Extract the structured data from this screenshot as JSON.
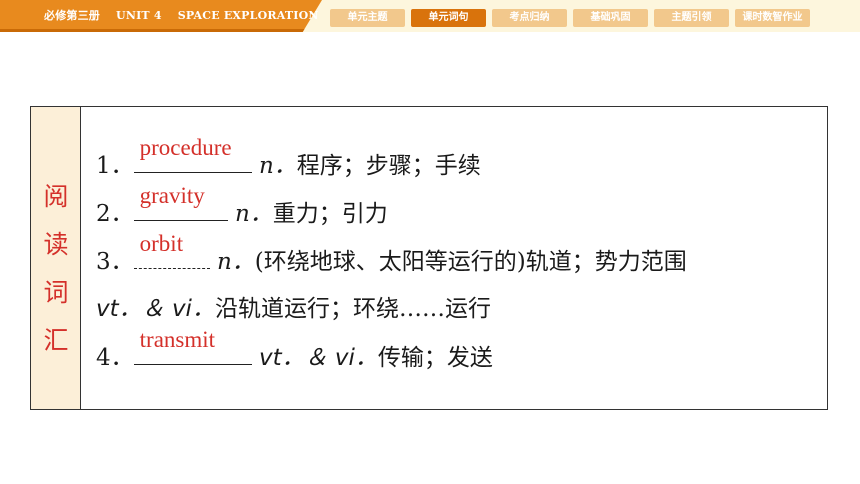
{
  "header": {
    "book": "必修第三册",
    "unit": "UNIT 4",
    "topic": "SPACE EXPLORATION"
  },
  "nav": {
    "tabs": [
      "单元主题",
      "单元词句",
      "考点归纳",
      "基础巩固",
      "主题引领",
      "课时数智作业"
    ],
    "active_index": 1
  },
  "section": {
    "label_chars": [
      "阅",
      "读",
      "词",
      "汇"
    ]
  },
  "vocab": [
    {
      "num": "1．",
      "answer": "procedure",
      "pos": "n．",
      "meaning": "程序；步骤；手续"
    },
    {
      "num": "2．",
      "answer": "gravity",
      "pos": "n．",
      "meaning": "重力；引力"
    },
    {
      "num": "3．",
      "answer": "orbit",
      "pos": "n．",
      "meaning": "(环绕地球、太阳等运行的)轨道；势力范围",
      "line2_pos": "vt．＆ vi．",
      "line2_meaning": "沿轨道运行；环绕……运行"
    },
    {
      "num": "4．",
      "answer": "transmit",
      "pos": "vt．＆ vi．",
      "meaning": "传输；发送"
    }
  ],
  "colors": {
    "header_orange": "#e88a1e",
    "tab_active": "#d9730c",
    "tab_inactive": "#f2c88c",
    "answer_red": "#d4302a",
    "side_bg": "#fcefd8"
  }
}
